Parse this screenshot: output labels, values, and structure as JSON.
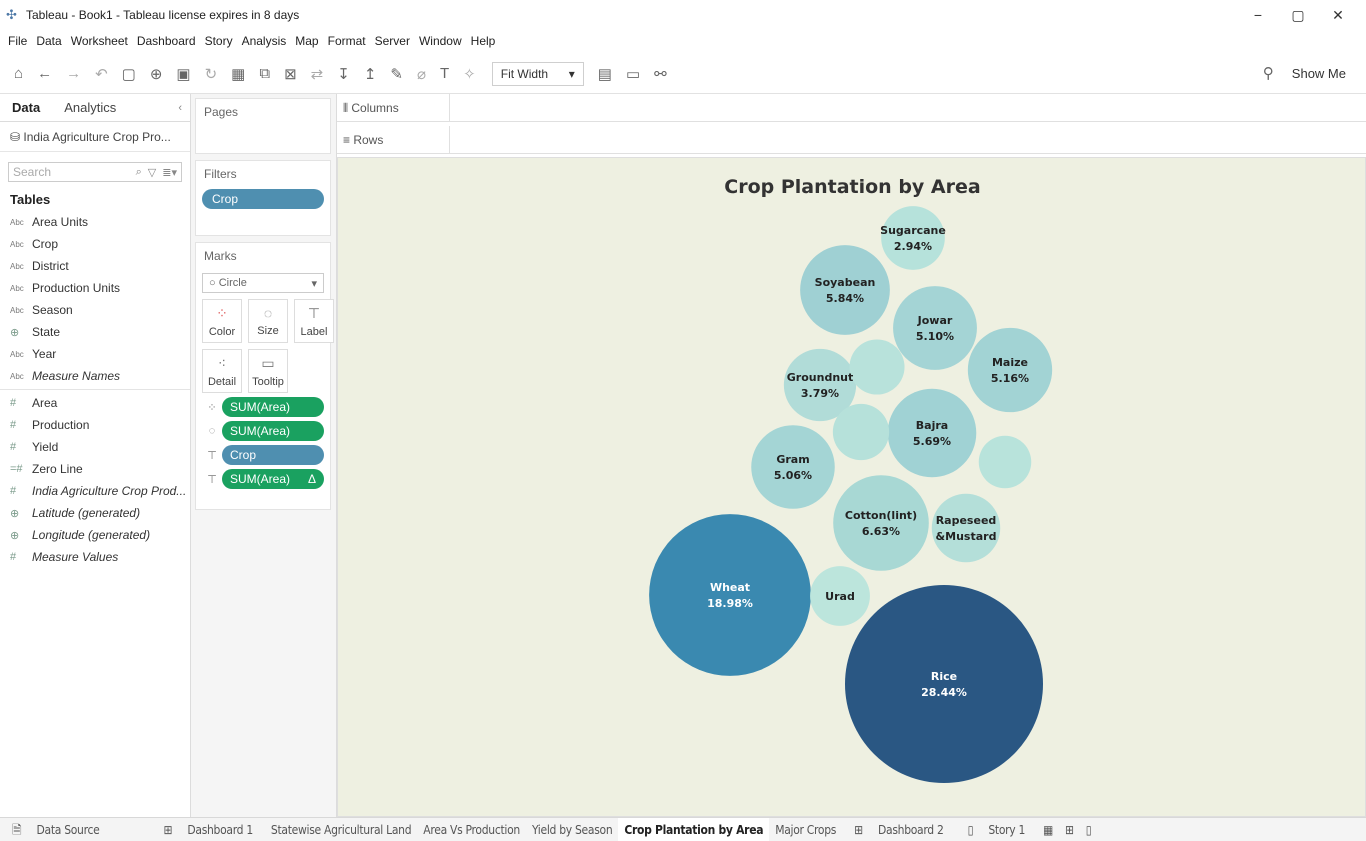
{
  "window": {
    "title": "Tableau - Book1 - Tableau license expires in 8 days",
    "controls": [
      "−",
      "▢",
      "✕"
    ]
  },
  "menu": [
    "File",
    "Data",
    "Worksheet",
    "Dashboard",
    "Story",
    "Analysis",
    "Map",
    "Format",
    "Server",
    "Window",
    "Help"
  ],
  "toolbar": {
    "fit": "Fit Width",
    "show_me": "Show Me"
  },
  "left_pane": {
    "tab_data": "Data",
    "tab_analytics": "Analytics",
    "datasource": "India Agriculture Crop Pro...",
    "search_placeholder": "Search",
    "tables_heading": "Tables",
    "dimensions": [
      {
        "type": "Abc",
        "name": "Area Units"
      },
      {
        "type": "Abc",
        "name": "Crop"
      },
      {
        "type": "Abc",
        "name": "District"
      },
      {
        "type": "Abc",
        "name": "Production Units"
      },
      {
        "type": "Abc",
        "name": "Season"
      },
      {
        "type": "⊕",
        "name": "State"
      },
      {
        "type": "Abc",
        "name": "Year"
      },
      {
        "type": "Abc",
        "name": "Measure Names"
      }
    ],
    "measures": [
      {
        "type": "#",
        "name": "Area"
      },
      {
        "type": "#",
        "name": "Production"
      },
      {
        "type": "#",
        "name": "Yield"
      },
      {
        "type": "=#",
        "name": "Zero Line"
      },
      {
        "type": "#",
        "name": "India Agriculture Crop Prod..."
      },
      {
        "type": "⊕",
        "name": "Latitude (generated)"
      },
      {
        "type": "⊕",
        "name": "Longitude (generated)"
      },
      {
        "type": "#",
        "name": "Measure Values"
      }
    ]
  },
  "cards": {
    "pages": "Pages",
    "filters": "Filters",
    "filter_pill": "Crop",
    "marks": "Marks",
    "mark_type": "Circle",
    "mark_buttons": [
      "Color",
      "Size",
      "Label",
      "Detail",
      "Tooltip"
    ],
    "mark_pills": [
      {
        "label": "SUM(Area)",
        "kind": "green",
        "extra": ""
      },
      {
        "label": "SUM(Area)",
        "kind": "green",
        "extra": ""
      },
      {
        "label": "Crop",
        "kind": "blue",
        "extra": ""
      },
      {
        "label": "SUM(Area)",
        "kind": "green",
        "extra": "Δ"
      }
    ]
  },
  "shelves": {
    "columns": "Columns",
    "rows": "Rows"
  },
  "chart_data": {
    "type": "bubble",
    "title": "Crop Plantation by Area",
    "measure": "SUM(Area)",
    "series": [
      {
        "name": "Rice",
        "value": 28.44,
        "label": "28.44%",
        "color": "#2a5783"
      },
      {
        "name": "Wheat",
        "value": 18.98,
        "label": "18.98%",
        "color": "#3a89b0"
      },
      {
        "name": "Cotton(lint)",
        "value": 6.63,
        "label": "6.63%",
        "color": "#a8d8d4"
      },
      {
        "name": "Sugarcane",
        "value": 2.94,
        "label": "2.94%",
        "color": "#b6e2db"
      },
      {
        "name": "Soyabean",
        "value": 5.84,
        "label": "5.84%",
        "color": "#9fd0d3"
      },
      {
        "name": "Bajra",
        "value": 5.69,
        "label": "5.69%",
        "color": "#a0d2d4"
      },
      {
        "name": "Maize",
        "value": 5.16,
        "label": "5.16%",
        "color": "#a2d3d4"
      },
      {
        "name": "Jowar",
        "value": 5.1,
        "label": "5.10%",
        "color": "#a4d4d5"
      },
      {
        "name": "Gram",
        "value": 5.06,
        "label": "5.06%",
        "color": "#a4d5d5"
      },
      {
        "name": "Groundnut",
        "value": 3.79,
        "label": "3.79%",
        "color": "#b1dcd8"
      },
      {
        "name": "Rapeseed &Mustard",
        "value": 3.4,
        "label": "",
        "color": "#b4dfd9"
      },
      {
        "name": "Urad",
        "value": 2.6,
        "label": "",
        "color": "#bce5dc"
      },
      {
        "name": "",
        "value": 2.2,
        "label": "",
        "color": "#b8e2db"
      },
      {
        "name": "",
        "value": 2.3,
        "label": "",
        "color": "#b6e1da"
      },
      {
        "name": "",
        "value": 2.0,
        "label": "",
        "color": "#b8e3db"
      }
    ]
  },
  "sheet_tabs": [
    {
      "label": "Data Source",
      "icon": "🗎",
      "active": false
    },
    {
      "label": "Dashboard 1",
      "icon": "⊞",
      "active": false
    },
    {
      "label": "Statewise Agricultural Land",
      "icon": "",
      "active": false
    },
    {
      "label": "Area Vs Production",
      "icon": "",
      "active": false
    },
    {
      "label": "Yield by Season",
      "icon": "",
      "active": false
    },
    {
      "label": "Crop Plantation by Area",
      "icon": "",
      "active": true
    },
    {
      "label": "Major Crops",
      "icon": "",
      "active": false
    },
    {
      "label": "Dashboard 2",
      "icon": "⊞",
      "active": false
    },
    {
      "label": "Story 1",
      "icon": "▯",
      "active": false
    }
  ]
}
